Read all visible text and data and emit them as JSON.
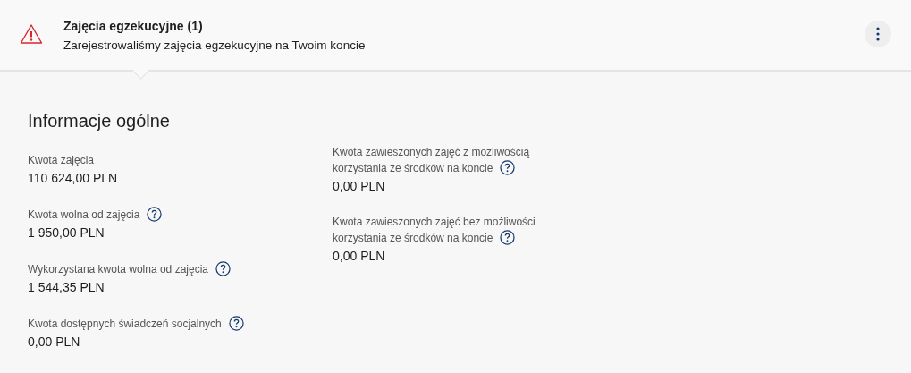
{
  "notification": {
    "title": "Zajęcia egzekucyjne (1)",
    "message": "Zarejestrowaliśmy zajęcia egzekucyjne na Twoim koncie"
  },
  "section": {
    "title": "Informacje ogólne",
    "columns": [
      [
        {
          "label": "Kwota zajęcia",
          "value": "110 624,00 PLN",
          "help": false
        },
        {
          "label": "Kwota wolna od zajęcia",
          "value": "1 950,00 PLN",
          "help": true
        },
        {
          "label": "Wykorzystana kwota wolna od zajęcia",
          "value": "1 544,35 PLN",
          "help": true
        },
        {
          "label": "Kwota dostępnych świadczeń socjalnych",
          "value": "0,00 PLN",
          "help": true
        }
      ],
      [
        {
          "label": "Kwota zawieszonych zajęć z możliwością korzystania ze środków na koncie",
          "value": "0,00 PLN",
          "help": true
        },
        {
          "label": "Kwota zawieszonych zajęć bez możliwości korzystania ze środków na koncie",
          "value": "0,00 PLN",
          "help": true
        }
      ]
    ]
  }
}
